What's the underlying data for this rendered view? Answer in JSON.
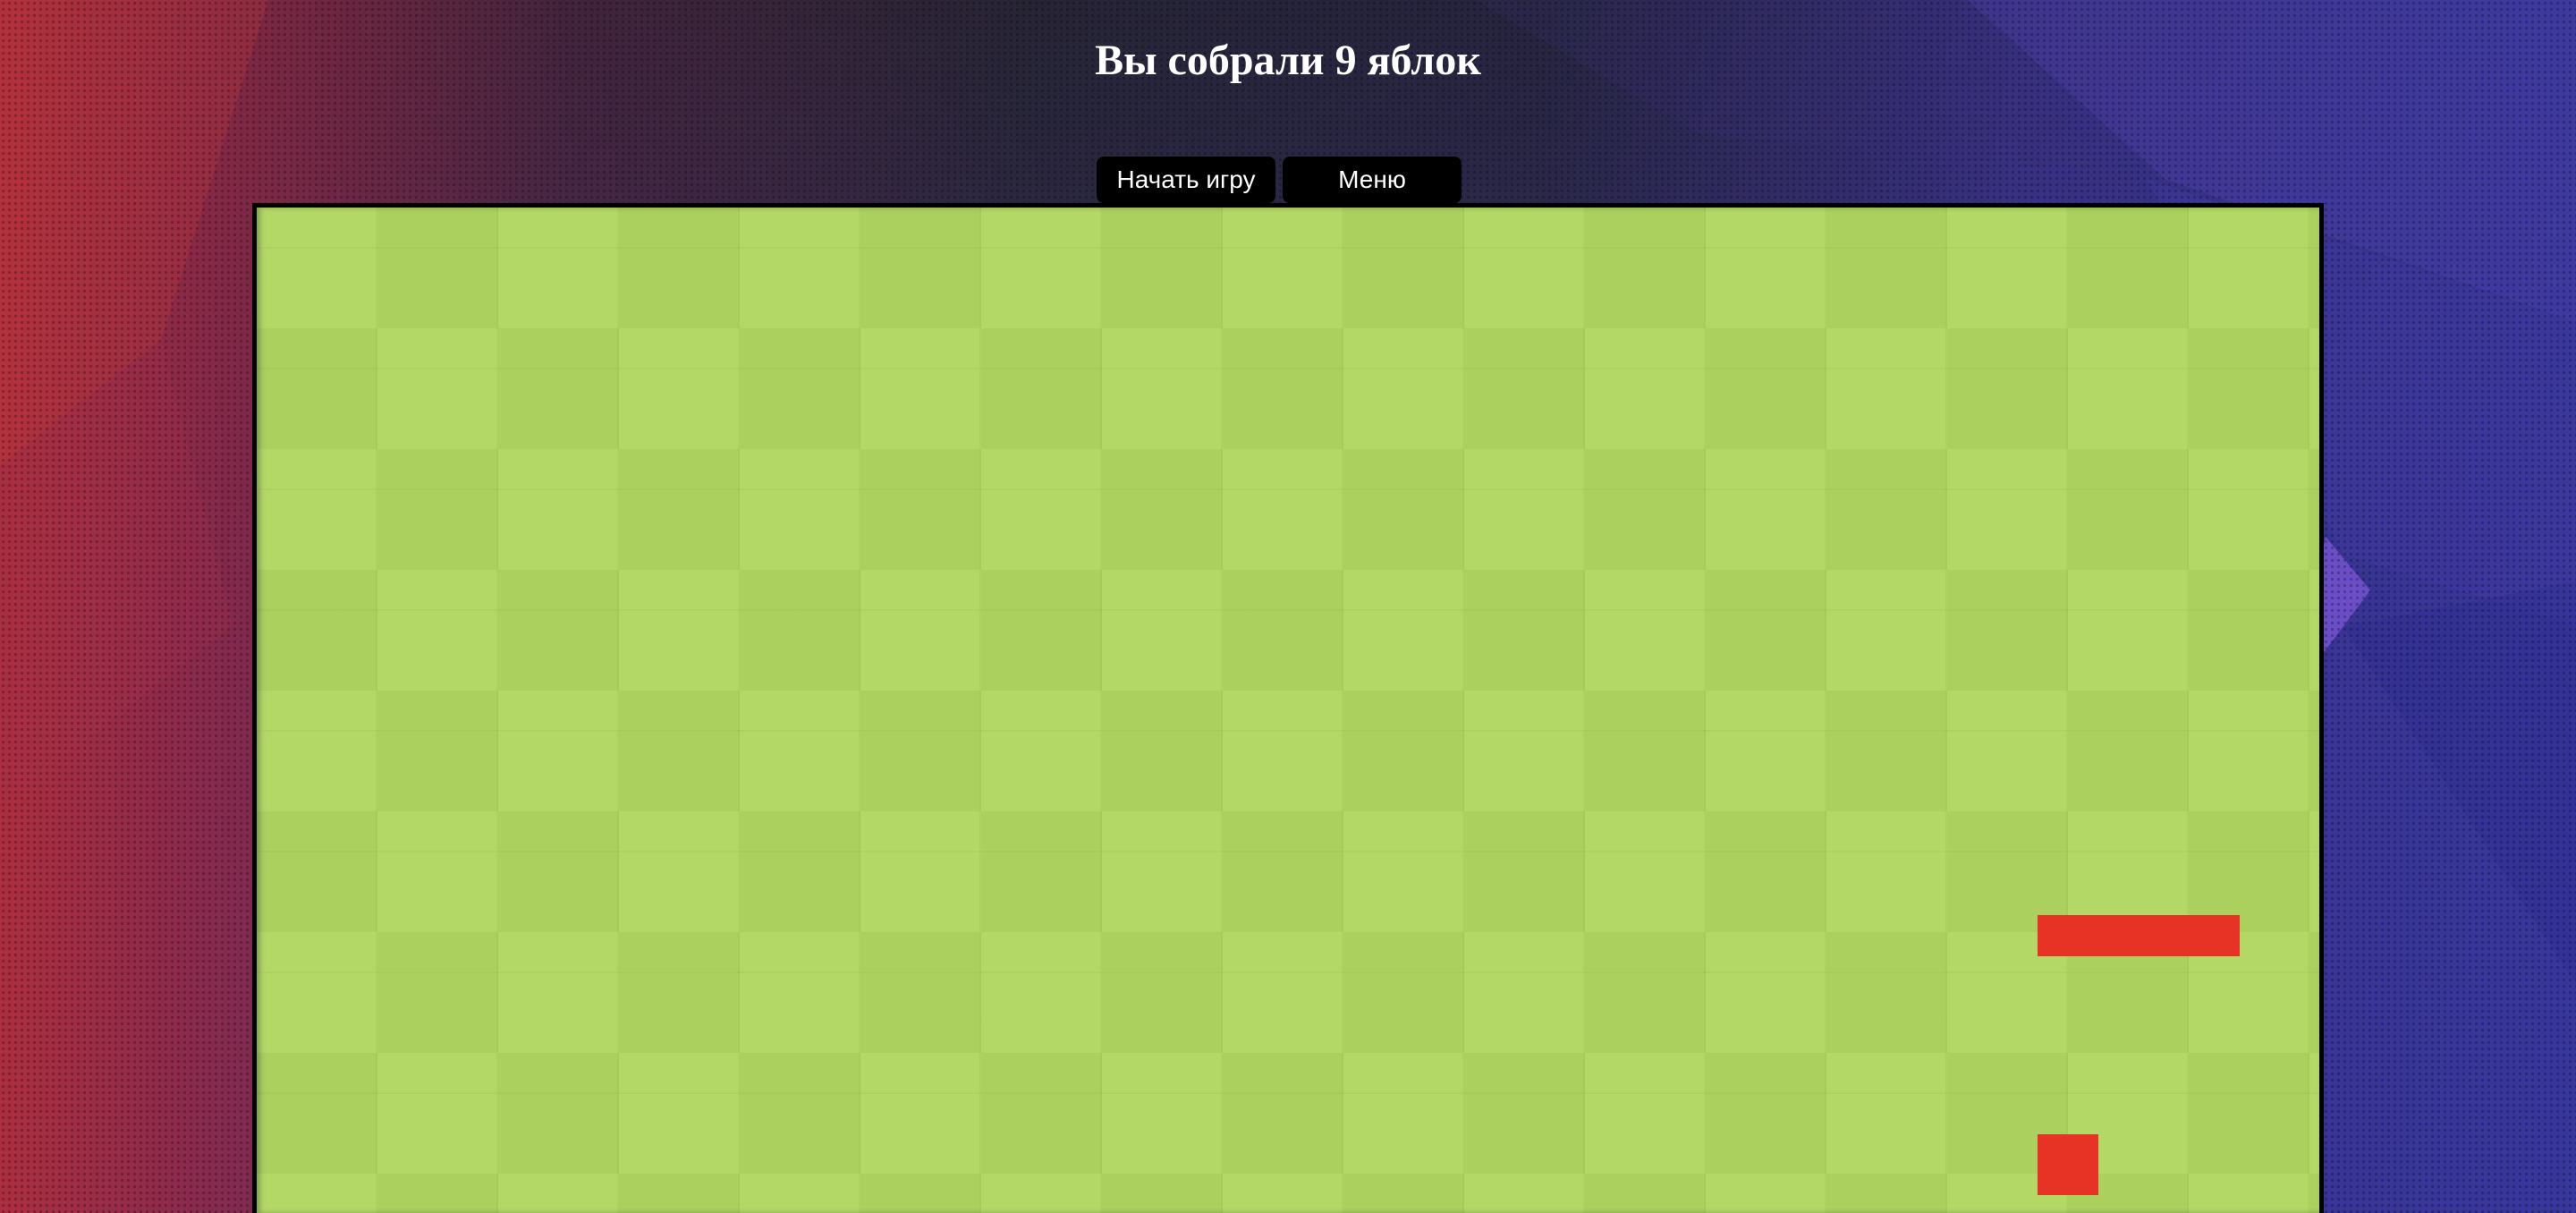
{
  "header": {
    "score_text": "Вы собрали 9 яблок"
  },
  "controls": {
    "start_label": "Начать игру",
    "menu_label": "Меню"
  },
  "game": {
    "apples_collected": 9,
    "board_colors": {
      "light": "#b4d866",
      "dark": "#abd05e",
      "border": "#000000"
    },
    "snake_color": "#e73325",
    "apple_color": "#e73325"
  },
  "theme": {
    "background_left": "#b02f3d",
    "background_right": "#3a3488",
    "button_bg": "#000000",
    "button_text": "#ffffff",
    "title_color": "#ffffff"
  }
}
